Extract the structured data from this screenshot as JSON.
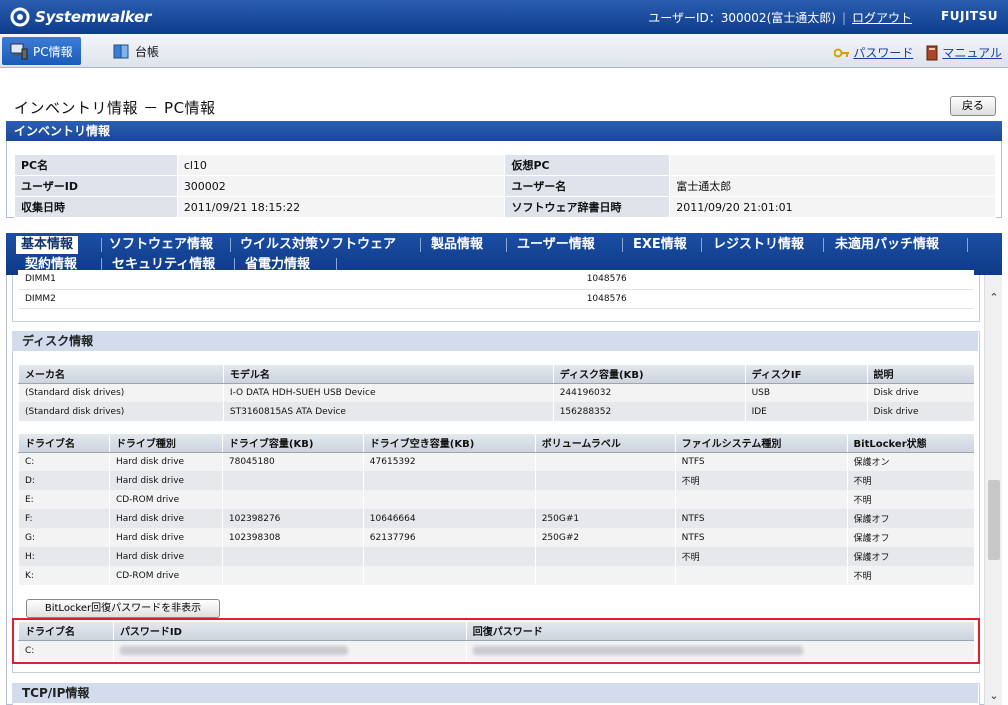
{
  "header": {
    "app_name": "Systemwalker",
    "user_label": "ユーザーID：300002(富士通太郎)",
    "separator": "|",
    "logout": "ログアウト",
    "vendor": "FUJITSU"
  },
  "nav": {
    "tabs": [
      {
        "label": "PC情報",
        "icon": "pc-icon",
        "active": true
      },
      {
        "label": "台帳",
        "icon": "ledger-icon",
        "active": false
      }
    ],
    "links": [
      {
        "label": "パスワード",
        "icon": "key-icon"
      },
      {
        "label": "マニュアル",
        "icon": "book-icon"
      }
    ]
  },
  "page": {
    "title": "インベントリ情報 － PC情報",
    "back_label": "戻る"
  },
  "inventory": {
    "section_title": "インベントリ情報",
    "rows": [
      {
        "l1": "PC名",
        "v1": "cl10",
        "l2": "仮想PC",
        "v2": ""
      },
      {
        "l1": "ユーザーID",
        "v1": "300002",
        "l2": "ユーザー名",
        "v2": "富士通太郎"
      },
      {
        "l1": "収集日時",
        "v1": "2011/09/21 18:15:22",
        "l2": "ソフトウェア辞書日時",
        "v2": "2011/09/20 21:01:01"
      }
    ]
  },
  "category_tabs": {
    "row1": [
      "基本情報",
      "ソフトウェア情報",
      "ウイルス対策ソフトウェア",
      "製品情報",
      "ユーザー情報",
      "EXE情報",
      "レジストリ情報",
      "未適用パッチ情報"
    ],
    "row2": [
      "契約情報",
      "セキュリティ情報",
      "省電力情報"
    ],
    "active": "基本情報"
  },
  "memory": {
    "rows": [
      {
        "name": "DIMM1",
        "size": "1048576"
      },
      {
        "name": "DIMM2",
        "size": "1048576"
      }
    ]
  },
  "disk": {
    "title": "ディスク情報",
    "disk_headers": [
      "メーカ名",
      "モデル名",
      "ディスク容量(KB)",
      "ディスクIF",
      "説明"
    ],
    "disks": [
      [
        "(Standard disk drives)",
        "I-O DATA HDH-SUEH USB Device",
        "244196032",
        "USB",
        "Disk drive"
      ],
      [
        "(Standard disk drives)",
        "ST3160815AS ATA Device",
        "156288352",
        "IDE",
        "Disk drive"
      ]
    ],
    "drive_headers": [
      "ドライブ名",
      "ドライブ種別",
      "ドライブ容量(KB)",
      "ドライブ空き容量(KB)",
      "ボリュームラベル",
      "ファイルシステム種別",
      "BitLocker状態"
    ],
    "drives": [
      [
        "C:",
        "Hard disk drive",
        "78045180",
        "47615392",
        "",
        "NTFS",
        "保護オン"
      ],
      [
        "D:",
        "Hard disk drive",
        "",
        "",
        "",
        "不明",
        "不明"
      ],
      [
        "E:",
        "CD-ROM drive",
        "",
        "",
        "",
        "",
        "不明"
      ],
      [
        "F:",
        "Hard disk drive",
        "102398276",
        "10646664",
        "250G#1",
        "NTFS",
        "保護オフ"
      ],
      [
        "G:",
        "Hard disk drive",
        "102398308",
        "62137796",
        "250G#2",
        "NTFS",
        "保護オフ"
      ],
      [
        "H:",
        "Hard disk drive",
        "",
        "",
        "",
        "不明",
        "保護オフ"
      ],
      [
        "K:",
        "CD-ROM drive",
        "",
        "",
        "",
        "",
        "不明"
      ]
    ],
    "bitlocker_button": "BitLocker回復パスワードを非表示",
    "recovery_headers": [
      "ドライブ名",
      "パスワードID",
      "回復パスワード"
    ],
    "recovery_rows": [
      {
        "drive": "C:"
      }
    ]
  },
  "tcpip": {
    "title": "TCP/IP情報"
  }
}
